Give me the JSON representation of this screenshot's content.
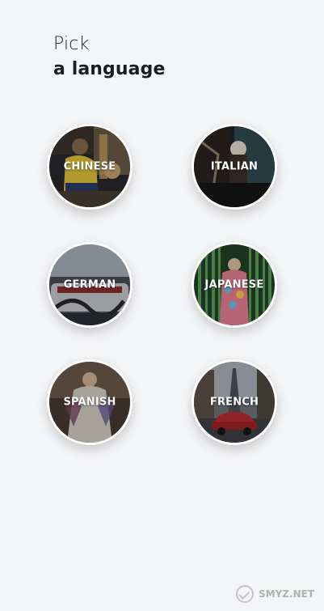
{
  "header": {
    "line1": "Pick",
    "line2": "a language"
  },
  "languages": [
    {
      "label": "CHINESE"
    },
    {
      "label": "ITALIAN"
    },
    {
      "label": "GERMAN"
    },
    {
      "label": "JAPANESE"
    },
    {
      "label": "SPANISH"
    },
    {
      "label": "FRENCH"
    }
  ],
  "watermark": {
    "text": "SMYZ.NET"
  },
  "colors": {
    "background": "#f4f5f7",
    "heading": "#1b1d22",
    "label": "#ffffff"
  }
}
